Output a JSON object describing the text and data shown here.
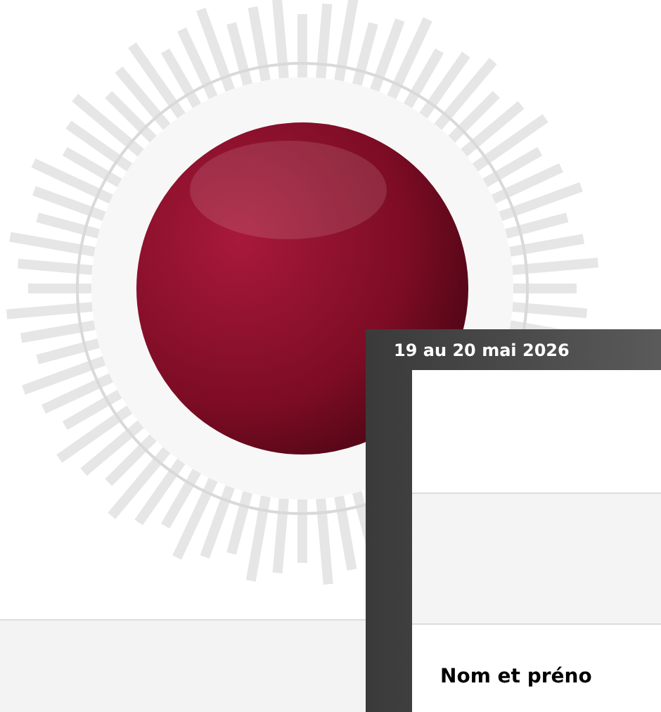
{
  "banner": {
    "date": "19 au 20 mai 2026"
  },
  "form": {
    "field_label": "Nom et préno"
  }
}
